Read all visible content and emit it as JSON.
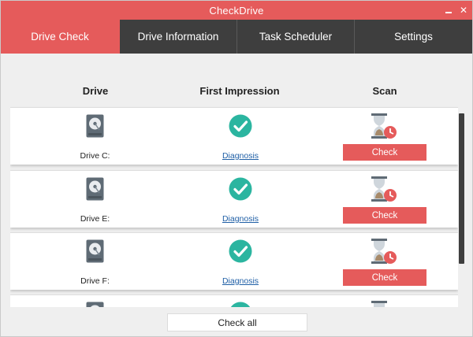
{
  "window": {
    "title": "CheckDrive"
  },
  "tabs": [
    {
      "label": "Drive Check",
      "active": true
    },
    {
      "label": "Drive Information",
      "active": false
    },
    {
      "label": "Task Scheduler",
      "active": false
    },
    {
      "label": "Settings",
      "active": false
    }
  ],
  "columns": {
    "drive": "Drive",
    "first_impression": "First Impression",
    "scan": "Scan"
  },
  "drives": [
    {
      "label": "Drive C:",
      "diagnosis": "Diagnosis",
      "check": "Check"
    },
    {
      "label": "Drive E:",
      "diagnosis": "Diagnosis",
      "check": "Check"
    },
    {
      "label": "Drive F:",
      "diagnosis": "Diagnosis",
      "check": "Check"
    },
    {
      "label": "",
      "diagnosis": "",
      "check": ""
    }
  ],
  "footer": {
    "check_all": "Check all"
  },
  "colors": {
    "accent": "#e55b5b",
    "dark": "#3e3e3e",
    "ok": "#2bb5a0",
    "link": "#1f5fa6"
  },
  "icons": {
    "drive": "hard-drive-icon",
    "status": "check-circle-icon",
    "scan": "hourglass-clock-icon"
  }
}
